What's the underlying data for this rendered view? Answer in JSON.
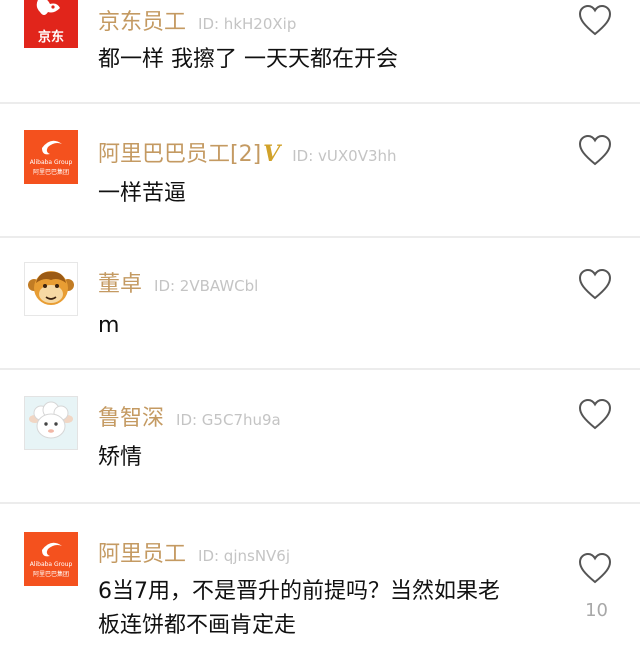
{
  "comments": [
    {
      "user": "京东员工",
      "id": "ID: hkH20Xip",
      "text": "都一样 我擦了 一天天都在开会",
      "avatar_text": "京东",
      "avatar": "jd-logo"
    },
    {
      "user": "阿里巴巴员工[2]",
      "badge": "V",
      "id": "ID: vUX0V3hh",
      "text": "一样苦逼",
      "avatar_text": "Alibaba Group",
      "avatar_subtext": "阿里巴巴集团",
      "avatar": "alibaba-logo"
    },
    {
      "user": "董卓",
      "id": "ID: 2VBAWCbl",
      "text": "m",
      "avatar": "monkey-icon"
    },
    {
      "user": "鲁智深",
      "id": "ID: G5C7hu9a",
      "text": "矫情",
      "avatar": "sheep-icon"
    },
    {
      "user": "阿里员工",
      "id": "ID: qjnsNV6j",
      "text_line1": "6当7用，不是晋升的前提吗？当然如果老",
      "text_line2": "板连饼都不画肯定走",
      "likes": "10",
      "avatar_text": "Alibaba Group",
      "avatar_subtext": "阿里巴巴集团",
      "avatar": "alibaba-logo"
    }
  ],
  "colors": {
    "username": "#c49a62",
    "id": "#c4c4c4",
    "jd_red": "#e1251b",
    "alibaba_orange": "#f4511e",
    "vip_gold": "#d1a22a"
  }
}
